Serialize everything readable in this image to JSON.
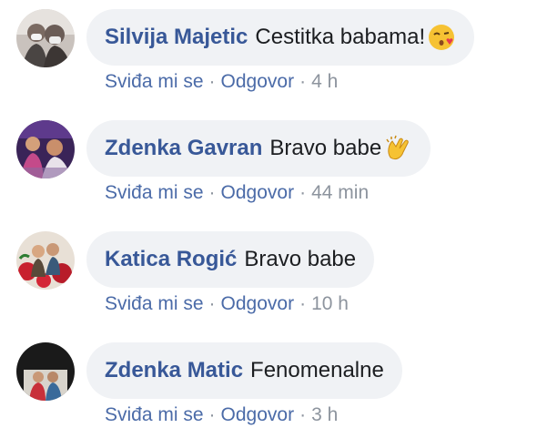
{
  "comments": [
    {
      "author": "Silvija Majetic",
      "text": "Cestitka babama!",
      "emoji": "kissing-face-emoji",
      "like_label": "Sviđa mi se",
      "reply_label": "Odgovor",
      "separator": "·",
      "time": "4 h"
    },
    {
      "author": "Zdenka Gavran",
      "text": "Bravo babe",
      "emoji": "clapping-hands-emoji",
      "like_label": "Sviđa mi se",
      "reply_label": "Odgovor",
      "separator": "·",
      "time": "44 min"
    },
    {
      "author": "Katica Rogić",
      "text": "Bravo babe",
      "emoji": "",
      "like_label": "Sviđa mi se",
      "reply_label": "Odgovor",
      "separator": "·",
      "time": "10 h"
    },
    {
      "author": "Zdenka Matic",
      "text": "Fenomenalne",
      "emoji": "",
      "like_label": "Sviđa mi se",
      "reply_label": "Odgovor",
      "separator": "·",
      "time": "3 h"
    }
  ]
}
